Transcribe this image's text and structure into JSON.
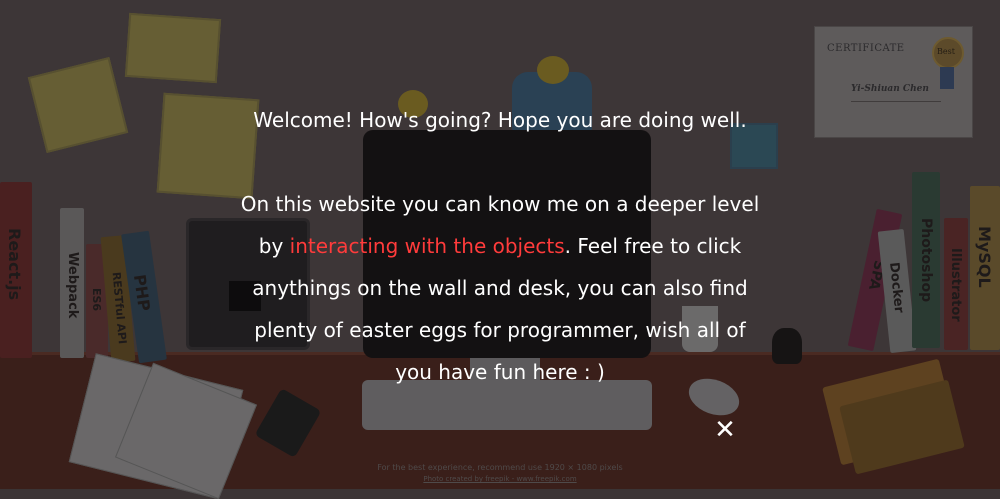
{
  "certificate": {
    "title": "CERTIFICATE",
    "badge": "Best",
    "name": "Yi-Shiuan Chen"
  },
  "books_left": [
    "React.js",
    "Webpack",
    "ES6",
    "RESTful API",
    "PHP"
  ],
  "books_right": [
    "SPA",
    "Docker",
    "Photoshop",
    "Illustrator",
    "MySQL"
  ],
  "modal": {
    "greeting": "Welcome! How's going? Hope you are doing well.",
    "line1": "On this website you can know me on a deeper level",
    "line2_prefix": "by ",
    "line2_link": "interacting with the objects",
    "line2_suffix": ". Feel free to click",
    "line3": "anythings on the wall and desk, you can also find",
    "line4": "plenty of easter eggs for programmer, wish all of",
    "line5": "you have fun here : )",
    "close_icon": "close-icon"
  },
  "footer": {
    "note": "For the best experience, recommend use 1920 × 1080 pixels",
    "credit": "Photo created by freepik - www.freepik.com"
  },
  "colors": {
    "highlight": "#ff3b3b",
    "text": "#ffffff",
    "overlay": "#3b3435"
  }
}
